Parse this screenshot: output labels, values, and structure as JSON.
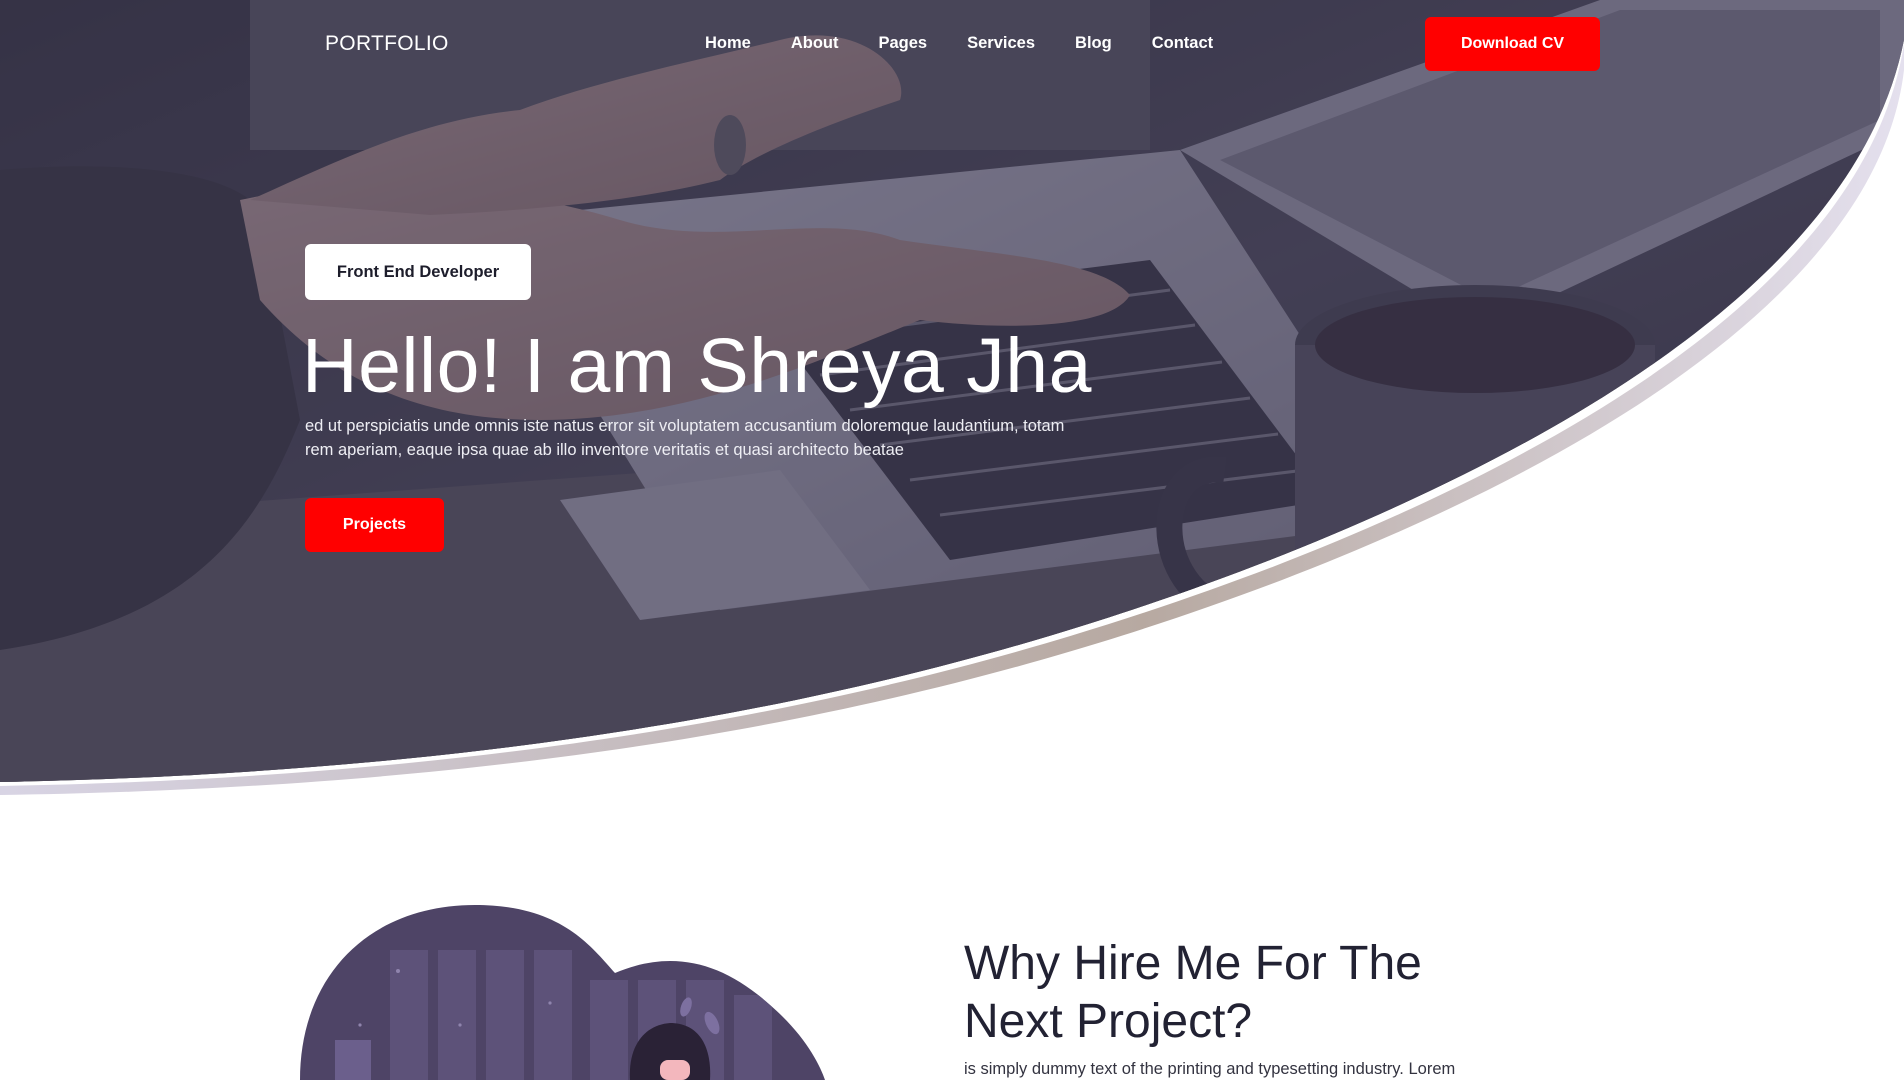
{
  "brand": {
    "logo": "PORTFOLIO"
  },
  "nav": {
    "links": [
      "Home",
      "About",
      "Pages",
      "Services",
      "Blog",
      "Contact"
    ],
    "download_label": "Download CV"
  },
  "hero": {
    "role": "Front End Developer",
    "title": "Hello! I am Shreya Jha",
    "description": "ed ut perspiciatis unde omnis iste natus error sit voluptatem accusantium doloremque laudantium, totam rem aperiam, eaque ipsa quae ab illo inventore veritatis et quasi architecto beatae",
    "cta_label": "Projects",
    "background_image": "laptop-typing-photo"
  },
  "about": {
    "heading": "Why Hire Me For The Next Project?",
    "text": "is simply dummy text of the printing and typesetting industry. Lorem",
    "illustration": "developer-illustration"
  },
  "colors": {
    "accent": "#ff0000",
    "overlay": "#3e3856",
    "text_dark": "#222233"
  }
}
